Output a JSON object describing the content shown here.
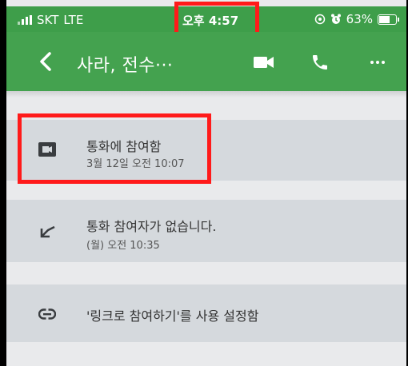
{
  "status_bar": {
    "carrier": "SKT",
    "network": "LTE",
    "time": "오후 4:57",
    "battery_text": "63%",
    "battery_level": 0.63,
    "icons": [
      "signal-icon",
      "location-icon",
      "alarm-icon",
      "battery-icon"
    ]
  },
  "header": {
    "title": "사라, 전수···",
    "icons": [
      "back-icon",
      "video-call-icon",
      "phone-icon",
      "more-icon"
    ]
  },
  "events": [
    {
      "icon": "video-icon",
      "title": "통화에 참여함",
      "subtitle": "3월 12일 오전 10:07"
    },
    {
      "icon": "missed-call-icon",
      "title": "통화 참여자가 없습니다.",
      "subtitle": "(월) 오전 10:35"
    },
    {
      "icon": "link-icon",
      "title": "'링크로 참여하기'를 사용 설정함",
      "subtitle": ""
    }
  ],
  "colors": {
    "brand_green": "#44a24f",
    "highlight_red": "#ff1a1a",
    "card_gray": "#d5d9dd"
  }
}
